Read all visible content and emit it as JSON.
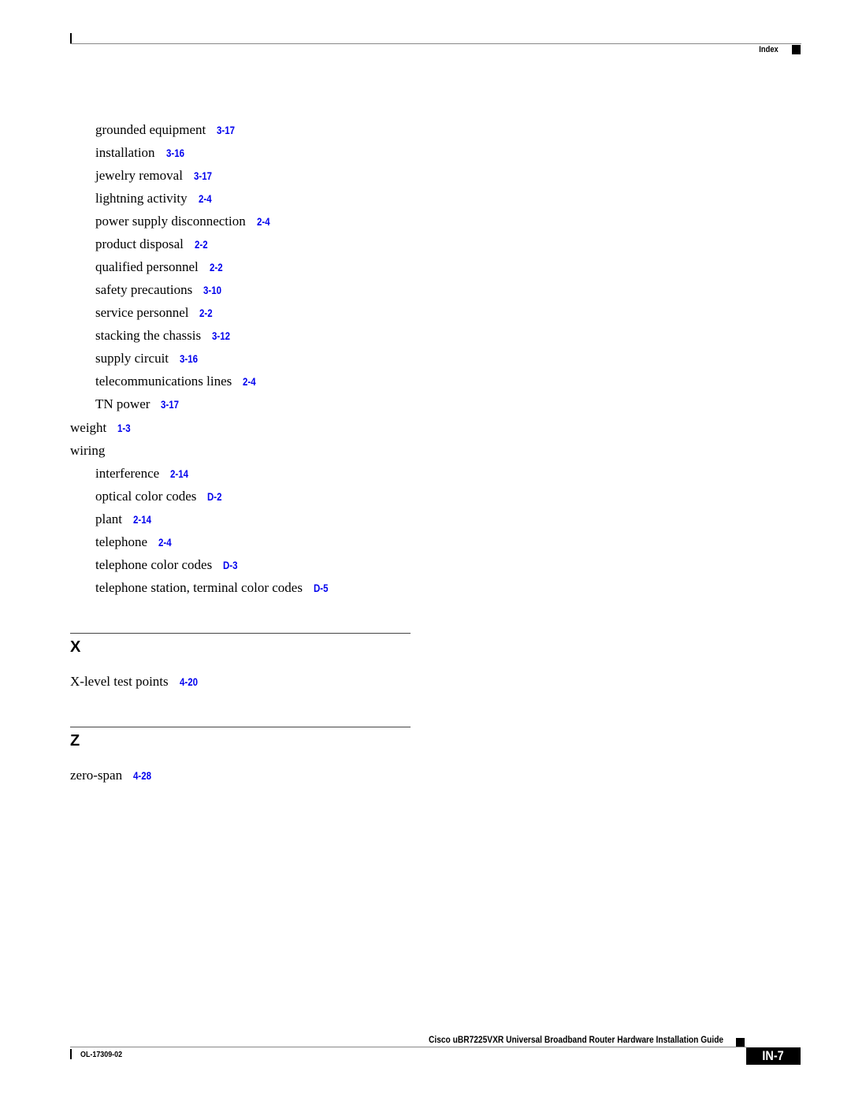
{
  "header": {
    "section_label": "Index"
  },
  "colors": {
    "link": "#0000ee",
    "text": "#000000"
  },
  "entries": [
    {
      "level": 2,
      "term": "grounded equipment",
      "page": "3-17"
    },
    {
      "level": 2,
      "term": "installation",
      "page": "3-16"
    },
    {
      "level": 2,
      "term": "jewelry removal",
      "page": "3-17"
    },
    {
      "level": 2,
      "term": "lightning activity",
      "page": "2-4"
    },
    {
      "level": 2,
      "term": "power supply disconnection",
      "page": "2-4"
    },
    {
      "level": 2,
      "term": "product disposal",
      "page": "2-2"
    },
    {
      "level": 2,
      "term": "qualified personnel",
      "page": "2-2"
    },
    {
      "level": 2,
      "term": "safety precautions",
      "page": "3-10"
    },
    {
      "level": 2,
      "term": "service personnel",
      "page": "2-2"
    },
    {
      "level": 2,
      "term": "stacking the chassis",
      "page": "3-12"
    },
    {
      "level": 2,
      "term": "supply circuit",
      "page": "3-16"
    },
    {
      "level": 2,
      "term": "telecommunications lines",
      "page": "2-4"
    },
    {
      "level": 2,
      "term": "TN power",
      "page": "3-17"
    },
    {
      "level": 1,
      "term": "weight",
      "page": "1-3"
    },
    {
      "level": 1,
      "term": "wiring",
      "page": ""
    },
    {
      "level": 2,
      "term": "interference",
      "page": "2-14"
    },
    {
      "level": 2,
      "term": "optical color codes",
      "page": "D-2"
    },
    {
      "level": 2,
      "term": "plant",
      "page": "2-14"
    },
    {
      "level": 2,
      "term": "telephone",
      "page": "2-4"
    },
    {
      "level": 2,
      "term": "telephone color codes",
      "page": "D-3"
    },
    {
      "level": 2,
      "term": "telephone station, terminal color codes",
      "page": "D-5"
    }
  ],
  "sections": [
    {
      "letter": "X",
      "entries": [
        {
          "level": 1,
          "term": "X-level test points",
          "page": "4-20"
        }
      ]
    },
    {
      "letter": "Z",
      "entries": [
        {
          "level": 1,
          "term": "zero-span",
          "page": "4-28"
        }
      ]
    }
  ],
  "footer": {
    "guide_title": "Cisco uBR7225VXR Universal Broadband Router Hardware Installation Guide",
    "doc_id": "OL-17309-02",
    "page_number": "IN-7"
  }
}
